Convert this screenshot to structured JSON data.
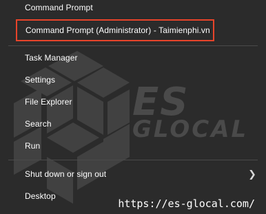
{
  "menu": {
    "items": [
      {
        "label": "Command Prompt"
      },
      {
        "label": "Command Prompt (Administrator) - Taimienphi.vn"
      },
      {
        "label": "Task Manager"
      },
      {
        "label": "Settings"
      },
      {
        "label": "File Explorer"
      },
      {
        "label": "Search"
      },
      {
        "label": "Run"
      },
      {
        "label": "Shut down or sign out"
      },
      {
        "label": "Desktop"
      }
    ]
  },
  "watermark": {
    "line1": "ES",
    "line2": "GLOCAL",
    "url": "https://es-glocal.com/"
  },
  "colors": {
    "background": "#2b2b2b",
    "highlight_border": "#e8442a",
    "separator": "#4a4a4a",
    "watermark": "#4a4a4a"
  },
  "icons": {
    "submenu": "chevron-right-icon",
    "logo": "cube-logo-icon"
  }
}
